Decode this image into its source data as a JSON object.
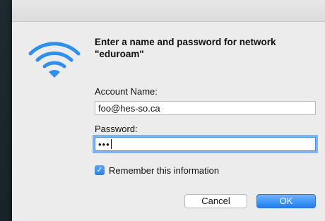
{
  "dialog": {
    "heading": "Enter a name and password for network \"eduroam\"",
    "account_label": "Account Name:",
    "account_value": "foo@hes-so.ca",
    "password_label": "Password:",
    "password_value": "•••",
    "remember_label": "Remember this information",
    "remember_checked": true,
    "cancel_label": "Cancel",
    "ok_label": "OK"
  },
  "icons": {
    "wifi": "wifi-icon",
    "checkbox": "checkmark-icon"
  },
  "colors": {
    "accent": "#2b7be6",
    "wifi": "#2f8fec",
    "dialog_bg": "#ececec"
  }
}
